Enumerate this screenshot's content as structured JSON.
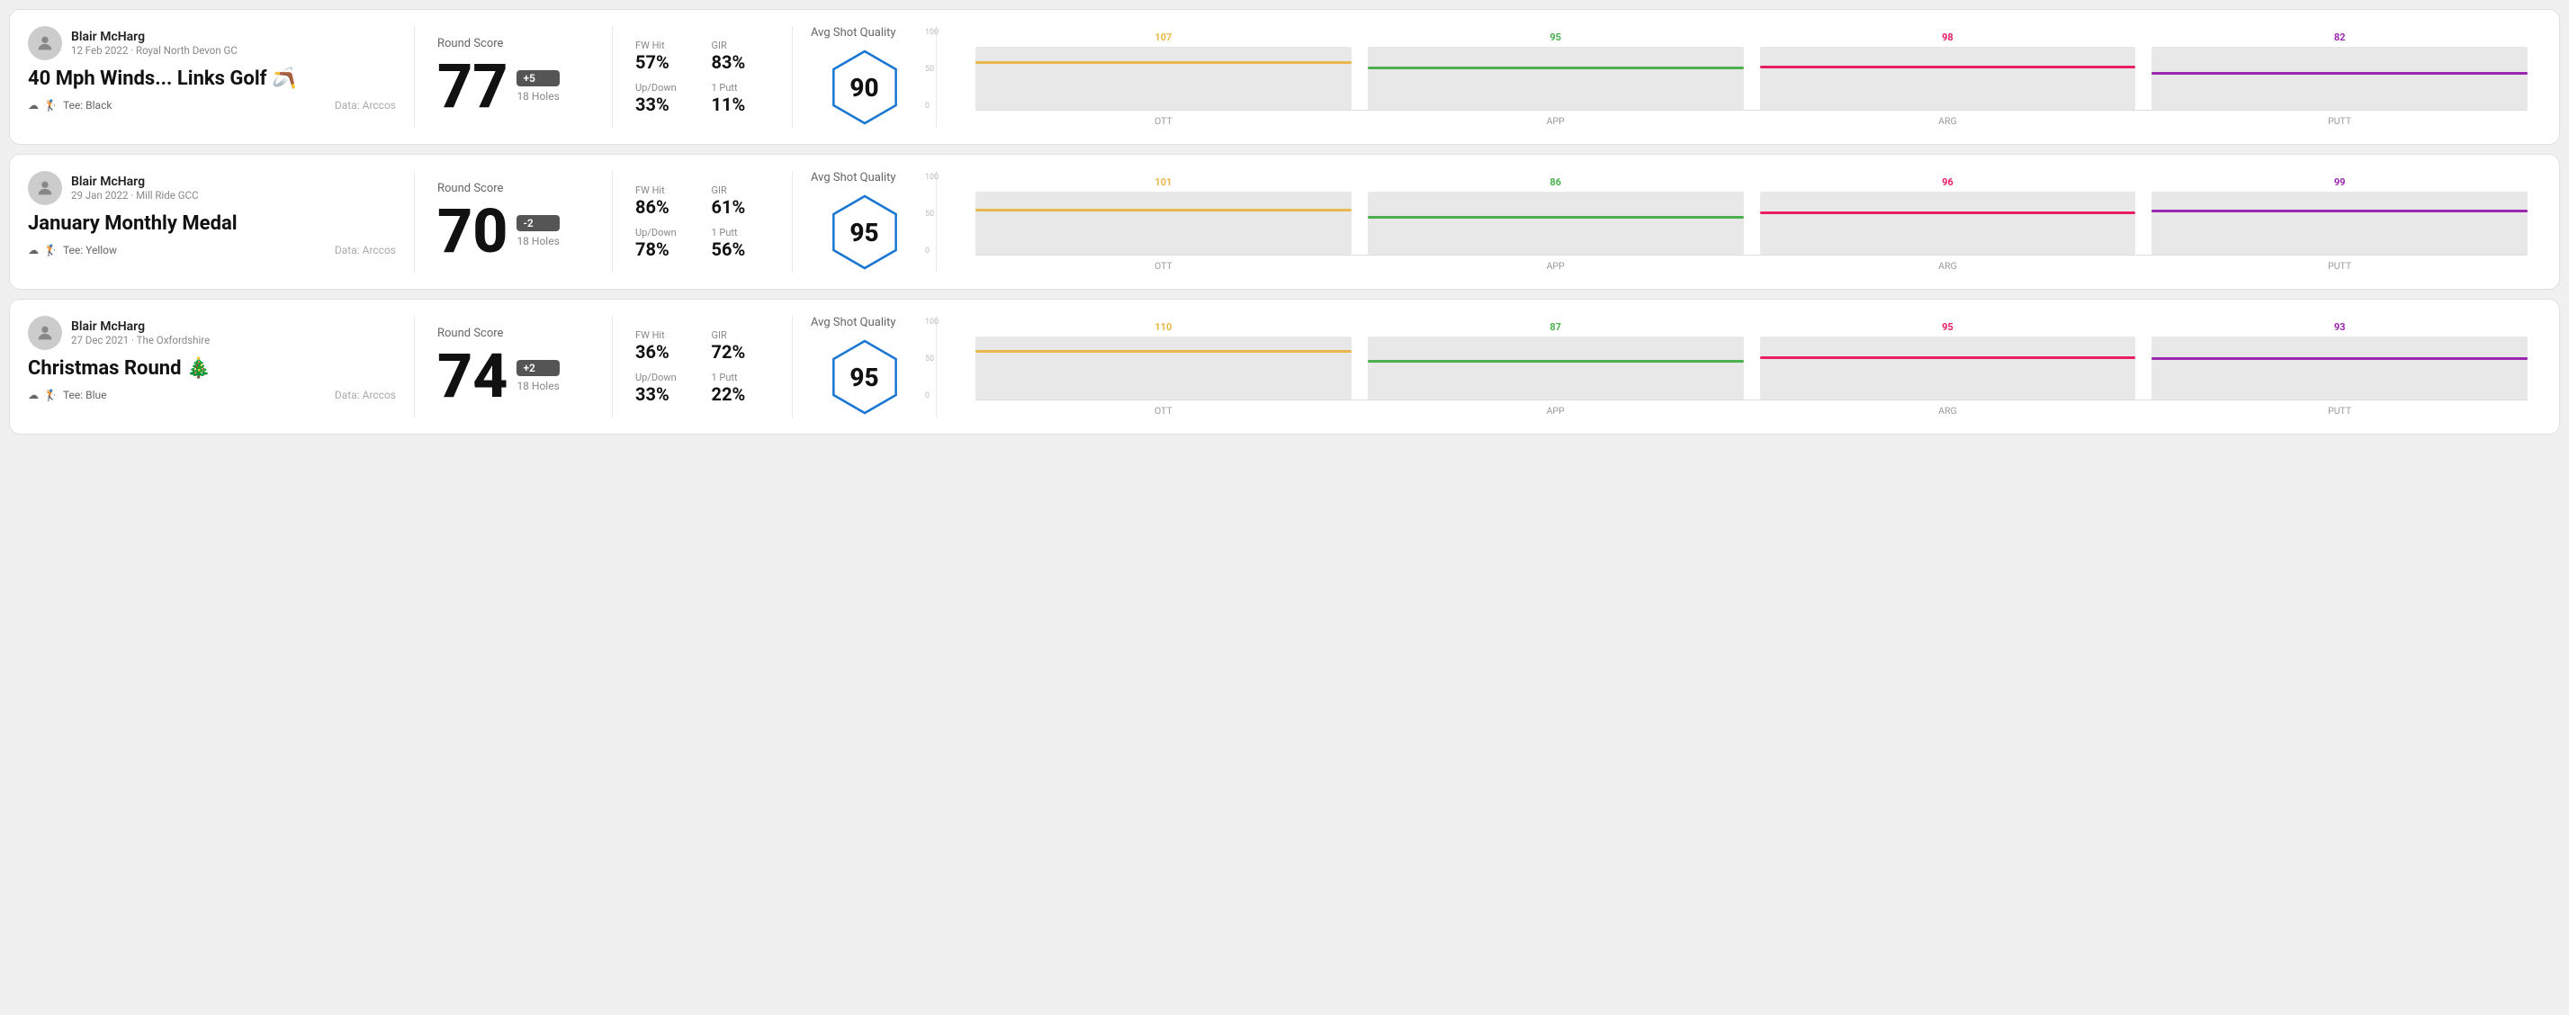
{
  "rounds": [
    {
      "id": "round-1",
      "user": {
        "name": "Blair McHarg",
        "date_course": "12 Feb 2022 · Royal North Devon GC"
      },
      "title": "40 Mph Winds... Links Golf 🪃",
      "tee": "Black",
      "data_source": "Data: Arccos",
      "score": "77",
      "score_badge": "+5",
      "badge_type": "over",
      "holes": "18 Holes",
      "stats": [
        {
          "label": "FW Hit",
          "value": "57%"
        },
        {
          "label": "GIR",
          "value": "83%"
        },
        {
          "label": "Up/Down",
          "value": "33%"
        },
        {
          "label": "1 Putt",
          "value": "11%"
        }
      ],
      "avg_shot_quality": "90",
      "chart": {
        "bars": [
          {
            "label": "OTT",
            "value": 107,
            "color": "#e8b84b",
            "pct": 72
          },
          {
            "label": "APP",
            "value": 95,
            "color": "#4caf50",
            "pct": 63
          },
          {
            "label": "ARG",
            "value": 98,
            "color": "#e91e63",
            "pct": 65
          },
          {
            "label": "PUTT",
            "value": 82,
            "color": "#9c27b0",
            "pct": 55
          }
        ],
        "y_labels": [
          "100",
          "50",
          "0"
        ]
      }
    },
    {
      "id": "round-2",
      "user": {
        "name": "Blair McHarg",
        "date_course": "29 Jan 2022 · Mill Ride GCC"
      },
      "title": "January Monthly Medal",
      "tee": "Yellow",
      "data_source": "Data: Arccos",
      "score": "70",
      "score_badge": "-2",
      "badge_type": "under",
      "holes": "18 Holes",
      "stats": [
        {
          "label": "FW Hit",
          "value": "86%"
        },
        {
          "label": "GIR",
          "value": "61%"
        },
        {
          "label": "Up/Down",
          "value": "78%"
        },
        {
          "label": "1 Putt",
          "value": "56%"
        }
      ],
      "avg_shot_quality": "95",
      "chart": {
        "bars": [
          {
            "label": "OTT",
            "value": 101,
            "color": "#e8b84b",
            "pct": 68
          },
          {
            "label": "APP",
            "value": 86,
            "color": "#4caf50",
            "pct": 57
          },
          {
            "label": "ARG",
            "value": 96,
            "color": "#e91e63",
            "pct": 64
          },
          {
            "label": "PUTT",
            "value": 99,
            "color": "#9c27b0",
            "pct": 66
          }
        ],
        "y_labels": [
          "100",
          "50",
          "0"
        ]
      }
    },
    {
      "id": "round-3",
      "user": {
        "name": "Blair McHarg",
        "date_course": "27 Dec 2021 · The Oxfordshire"
      },
      "title": "Christmas Round 🎄",
      "tee": "Blue",
      "data_source": "Data: Arccos",
      "score": "74",
      "score_badge": "+2",
      "badge_type": "over",
      "holes": "18 Holes",
      "stats": [
        {
          "label": "FW Hit",
          "value": "36%"
        },
        {
          "label": "GIR",
          "value": "72%"
        },
        {
          "label": "Up/Down",
          "value": "33%"
        },
        {
          "label": "1 Putt",
          "value": "22%"
        }
      ],
      "avg_shot_quality": "95",
      "chart": {
        "bars": [
          {
            "label": "OTT",
            "value": 110,
            "color": "#e8b84b",
            "pct": 74
          },
          {
            "label": "APP",
            "value": 87,
            "color": "#4caf50",
            "pct": 58
          },
          {
            "label": "ARG",
            "value": 95,
            "color": "#e91e63",
            "pct": 63
          },
          {
            "label": "PUTT",
            "value": 93,
            "color": "#9c27b0",
            "pct": 62
          }
        ],
        "y_labels": [
          "100",
          "50",
          "0"
        ]
      }
    }
  ],
  "labels": {
    "round_score": "Round Score",
    "avg_shot_quality": "Avg Shot Quality",
    "data_arccos": "Data: Arccos",
    "tee_prefix": "Tee:"
  }
}
